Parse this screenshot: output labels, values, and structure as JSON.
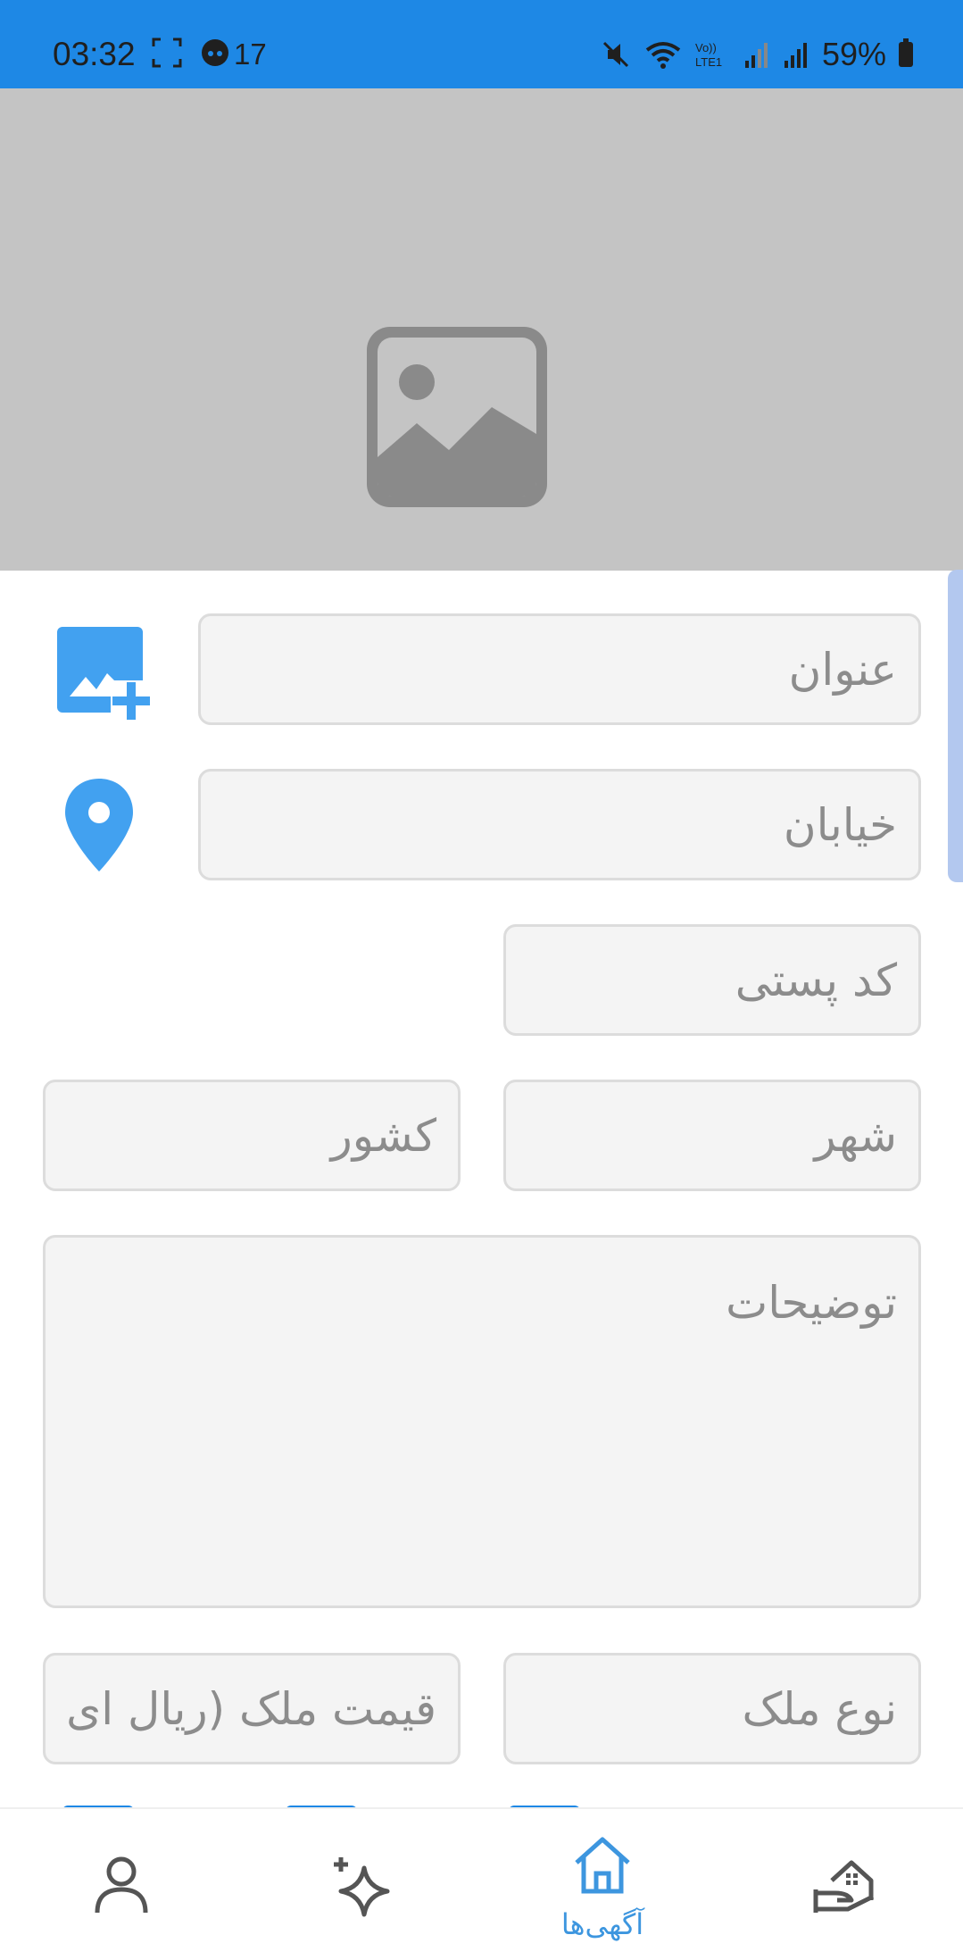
{
  "status_bar": {
    "time": "03:32",
    "count": "17",
    "battery": "59%",
    "background": "#1e88e5"
  },
  "image": {
    "placeholder_icon": "image-placeholder-icon",
    "background": "#c4c4c4"
  },
  "form": {
    "title_placeholder": "عنوان",
    "street_placeholder": "خیابان",
    "postal_code_placeholder": "کد پستی",
    "city_placeholder": "شهر",
    "country_placeholder": "کشور",
    "description_placeholder": "توضیحات",
    "property_type_placeholder": "نوع ملک",
    "price_placeholder": "قیمت ملک (ریال ای"
  },
  "side_icons": {
    "add_image": "add-image-icon",
    "location": "location-pin-icon"
  },
  "bottom_nav": {
    "items": [
      {
        "icon": "profile-icon",
        "label": ""
      },
      {
        "icon": "sparkle-icon",
        "label": ""
      },
      {
        "icon": "home-icon",
        "label": "آگهی‌ها",
        "active": true
      },
      {
        "icon": "property-hand-icon",
        "label": ""
      }
    ],
    "active_color": "#3d96df"
  },
  "accent": "#1e88e5",
  "icon_blue": "#42a1f0"
}
